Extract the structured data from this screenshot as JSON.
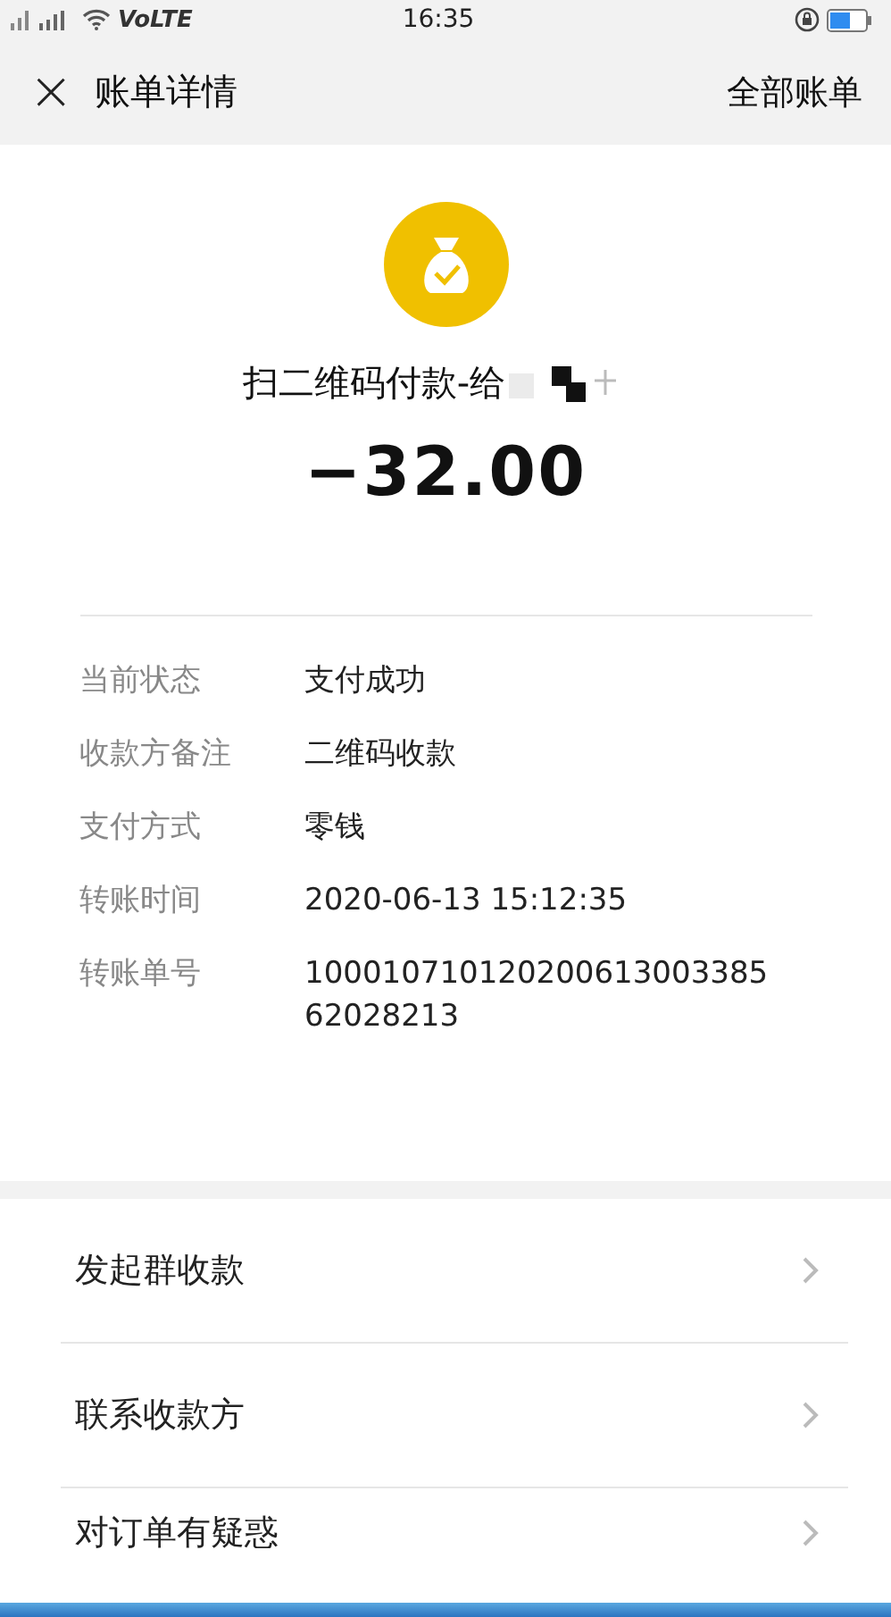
{
  "status_bar": {
    "network": "VoLTE",
    "time": "16:35"
  },
  "nav": {
    "close": "×",
    "title": "账单详情",
    "action": "全部账单"
  },
  "summary": {
    "title": "扫二维码付款-给",
    "amount": "−32.00"
  },
  "details": [
    {
      "label": "当前状态",
      "value": "支付成功"
    },
    {
      "label": "收款方备注",
      "value": "二维码收款"
    },
    {
      "label": "支付方式",
      "value": "零钱"
    },
    {
      "label": "转账时间",
      "value": "2020-06-13 15:12:35"
    },
    {
      "label": "转账单号",
      "value": "10001071012020061300338562028213"
    }
  ],
  "actions": [
    {
      "label": "发起群收款"
    },
    {
      "label": "联系收款方"
    },
    {
      "label": "对订单有疑惑"
    }
  ]
}
